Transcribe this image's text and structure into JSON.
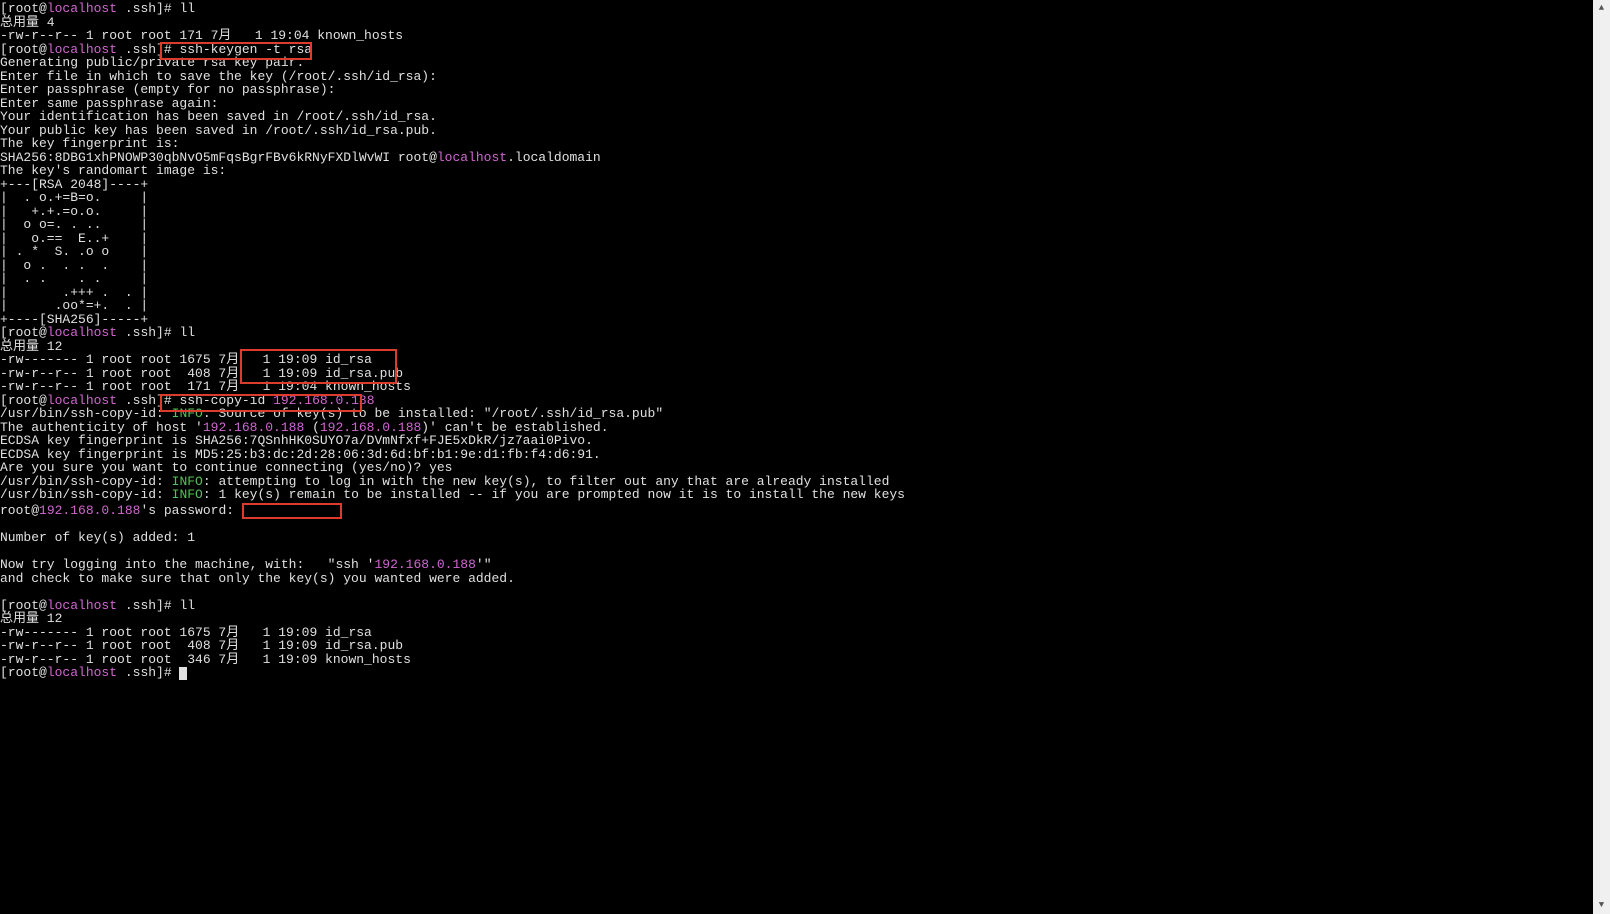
{
  "prompt": {
    "openBracket": "[",
    "userAt": "root@",
    "host": "localhost",
    "dir": " .ssh]# ",
    "dir_plain": " .ssh]#"
  },
  "cmd": {
    "ll": "ll",
    "keygen": "ssh-keygen -t rsa",
    "copyid_pre": "ssh-copy-id ",
    "copyid_ip": "192.168.0.188"
  },
  "ll1": {
    "total": "总用量 4",
    "line1": "-rw-r--r-- 1 root root 171 7月   1 19:04 known_hosts"
  },
  "keygen_out": {
    "l1": "Generating public/private rsa key pair.",
    "l2": "Enter file in which to save the key (/root/.ssh/id_rsa): ",
    "l3": "Enter passphrase (empty for no passphrase): ",
    "l4": "Enter same passphrase again: ",
    "l5": "Your identification has been saved in /root/.ssh/id_rsa.",
    "l6": "Your public key has been saved in /root/.ssh/id_rsa.pub.",
    "l7": "The key fingerprint is:",
    "l8a": "SHA256:8DBG1xhPNOWP30qbNvO5mFqsBgrFBv6kRNyFXDlWvWI root@",
    "l8b": "localhost",
    "l8c": ".localdomain",
    "l9": "The key's randomart image is:",
    "art": [
      "+---[RSA 2048]----+",
      "|  . o.+=B=o.     |",
      "|   +.+.=o.o.     |",
      "|  o o=. . ..     |",
      "|   o.==  E..+    |",
      "| . *  S. .o o    |",
      "|  o .  . .  .    |",
      "|  . .    . .     |",
      "|       .+++ .  . |",
      "|      .oo*=+.  . |",
      "+----[SHA256]-----+"
    ]
  },
  "ll2": {
    "total": "总用量 12",
    "r1_left": "-rw------- 1 root root 1675 7月",
    "r1_right": "   1 19:09 id_rsa",
    "r2_left": "-rw-r--r-- 1 root root  408 7月",
    "r2_right": "   1 19:09 id_rsa.pub",
    "r3": "-rw-r--r-- 1 root root  171 7月   1 19:04 known_hosts"
  },
  "copyid_out": {
    "l1a": "/usr/bin/ssh-copy-id: ",
    "l1b": "INFO",
    "l1c": ": Source of key(s) to be installed: \"/root/.ssh/id_rsa.pub\"",
    "l2a": "The authenticity of host '",
    "l2b": "192.168.0.188",
    "l2c": " (",
    "l2d": "192.168.0.188",
    "l2e": ")' can't be established.",
    "l3": "ECDSA key fingerprint is SHA256:7QSnhHK0SUYO7a/DVmNfxf+FJE5xDkR/jz7aai0Pivo.",
    "l4": "ECDSA key fingerprint is MD5:25:b3:dc:2d:28:06:3d:6d:bf:b1:9e:d1:fb:f4:d6:91.",
    "l5": "Are you sure you want to continue connecting (yes/no)? yes",
    "l6a": "/usr/bin/ssh-copy-id: ",
    "l6b": "INFO",
    "l6c": ": attempting to log in with the new key(s), to filter out any that are already installed",
    "l7a": "/usr/bin/ssh-copy-id: ",
    "l7b": "INFO",
    "l7c": ": 1 key(s) remain to be installed -- if you are prompted now it is to install the new keys",
    "l8a": "root@",
    "l8b": "192.168.0.188",
    "l8c": "'s password: ",
    "l9": "Number of key(s) added: 1",
    "l10a": "Now try logging into the machine, with:   \"ssh '",
    "l10b": "192.168.0.188",
    "l10c": "'\"",
    "l11": "and check to make sure that only the key(s) you wanted were added."
  },
  "ll3": {
    "total": "总用量 12",
    "r1": "-rw------- 1 root root 1675 7月   1 19:09 id_rsa",
    "r2": "-rw-r--r-- 1 root root  408 7月   1 19:09 id_rsa.pub",
    "r3": "-rw-r--r-- 1 root root  346 7月   1 19:09 known_hosts"
  },
  "scrollbar": {
    "up": "▲",
    "down": "▼"
  }
}
